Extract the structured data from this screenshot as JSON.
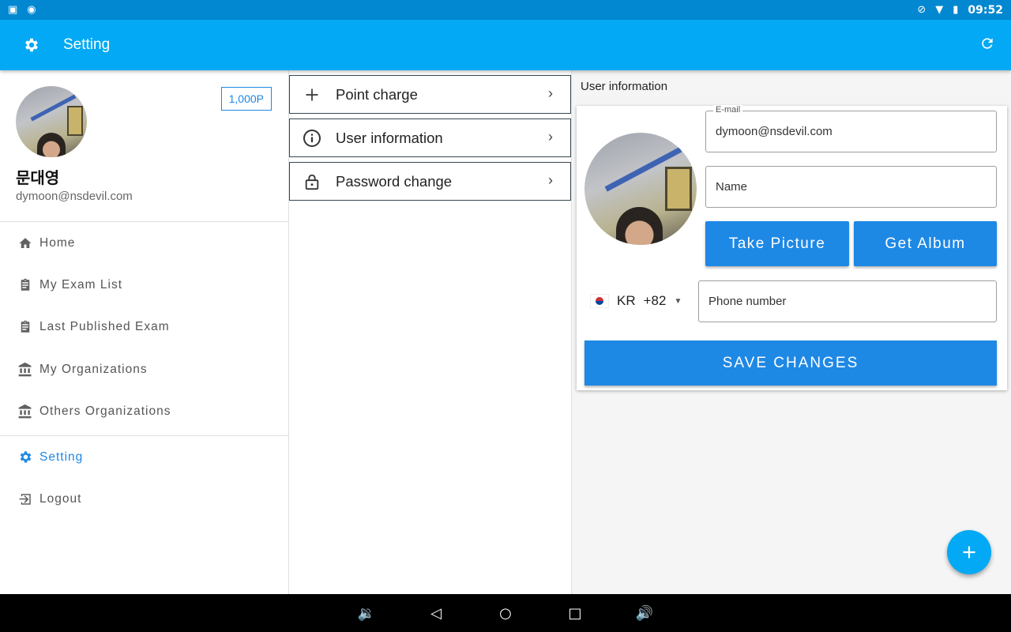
{
  "status_bar": {
    "time": "09:52"
  },
  "app_bar": {
    "title": "Setting"
  },
  "drawer": {
    "points": "1,000P",
    "user_name": "문대영",
    "user_email": "dymoon@nsdevil.com",
    "items": [
      {
        "label": "Home",
        "icon": "home-icon"
      },
      {
        "label": "My Exam List",
        "icon": "clipboard-icon"
      },
      {
        "label": "Last Published Exam",
        "icon": "clipboard-icon"
      },
      {
        "label": "My Organizations",
        "icon": "institution-icon"
      },
      {
        "label": "Others Organizations",
        "icon": "institution-icon"
      }
    ],
    "items2": [
      {
        "label": "Setting",
        "icon": "gear-icon"
      },
      {
        "label": "Logout",
        "icon": "logout-icon"
      }
    ]
  },
  "menu": {
    "items": [
      {
        "label": "Point charge",
        "icon": "plus-icon"
      },
      {
        "label": "User information",
        "icon": "info-icon"
      },
      {
        "label": "Password change",
        "icon": "lock-icon"
      }
    ]
  },
  "panel": {
    "title": "User information",
    "email_label": "E-mail",
    "email_value": "dymoon@nsdevil.com",
    "name_placeholder": "Name",
    "take_picture": "Take Picture",
    "get_album": "Get Album",
    "country_code": "KR",
    "dial_code": "+82",
    "phone_placeholder": "Phone number",
    "save": "SAVE CHANGES"
  },
  "colors": {
    "primary": "#03a9f4",
    "primary_dark": "#0288d1",
    "button": "#1e88e5"
  }
}
